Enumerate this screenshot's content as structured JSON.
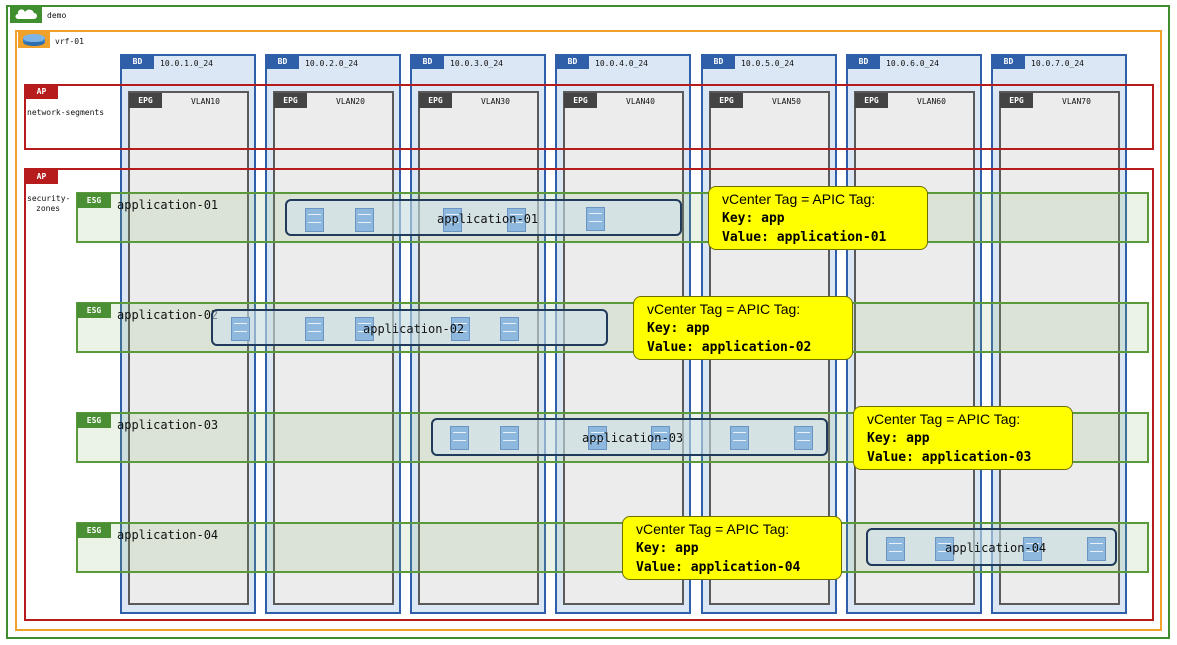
{
  "tenant": {
    "name": "demo"
  },
  "vrf": {
    "name": "vrf-01"
  },
  "labels": {
    "bd": "BD",
    "epg": "EPG",
    "ap": "AP",
    "esg": "ESG"
  },
  "bridge_domains": [
    {
      "subnet": "10.0.1.0_24",
      "epg": "VLAN10"
    },
    {
      "subnet": "10.0.2.0_24",
      "epg": "VLAN20"
    },
    {
      "subnet": "10.0.3.0_24",
      "epg": "VLAN30"
    },
    {
      "subnet": "10.0.4.0_24",
      "epg": "VLAN40"
    },
    {
      "subnet": "10.0.5.0_24",
      "epg": "VLAN50"
    },
    {
      "subnet": "10.0.6.0_24",
      "epg": "VLAN60"
    },
    {
      "subnet": "10.0.7.0_24",
      "epg": "VLAN70"
    }
  ],
  "app_profiles": [
    {
      "name": "network-segments"
    },
    {
      "name_line1": "security-",
      "name_line2": "zones"
    }
  ],
  "esgs": [
    {
      "name": "application-01",
      "group": "application-01"
    },
    {
      "name": "application-02",
      "group": "application-02"
    },
    {
      "name": "application-03",
      "group": "application-03"
    },
    {
      "name": "application-04",
      "group": "application-04"
    }
  ],
  "callouts": [
    {
      "title": "vCenter Tag = APIC Tag:",
      "key": "Key: app",
      "value": "Value: application-01"
    },
    {
      "title": "vCenter Tag = APIC Tag:",
      "key": "Key: app",
      "value": "Value: application-02"
    },
    {
      "title": "vCenter Tag = APIC Tag:",
      "key": "Key: app",
      "value": "Value: application-03"
    },
    {
      "title": "vCenter Tag = APIC Tag:",
      "key": "Key: app",
      "value": "Value: application-04"
    }
  ],
  "icons": {
    "tenant": "cloud-icon",
    "vrf": "router-icon",
    "vm": "server-icon"
  },
  "colors": {
    "tenant": "#3f8f2e",
    "vrf": "#f0a12a",
    "bd": "#2f5fa8",
    "ap": "#b71c1c",
    "esg": "#5a9a3a",
    "callout": "#ffff00"
  }
}
